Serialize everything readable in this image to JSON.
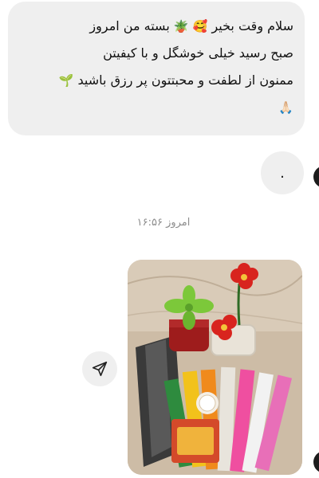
{
  "message": {
    "line1_text": "سلام وقت بخیر",
    "line1_text_b": "بسته من امروز",
    "line1_emoji_a": "🥰",
    "line1_emoji_b": "🪴",
    "line2_text": "صبح رسید خیلی خوشگل و با کیفیتن",
    "line3_text": "ممنون از لطفت و محبتتون پر رزق باشید",
    "line3_emoji": "🌱",
    "line4_emoji": "🙏🏻"
  },
  "reply_dot": {
    "text": "."
  },
  "timestamp": {
    "text": "امروز ۱۶:۵۶"
  },
  "share_button": {
    "icon": "send-icon"
  },
  "photo": {
    "content": "product-photo-flower-pipe-cleaners"
  },
  "colors": {
    "bubble_bg": "#efefef",
    "text": "#111111",
    "timestamp": "#8e8e8e"
  }
}
